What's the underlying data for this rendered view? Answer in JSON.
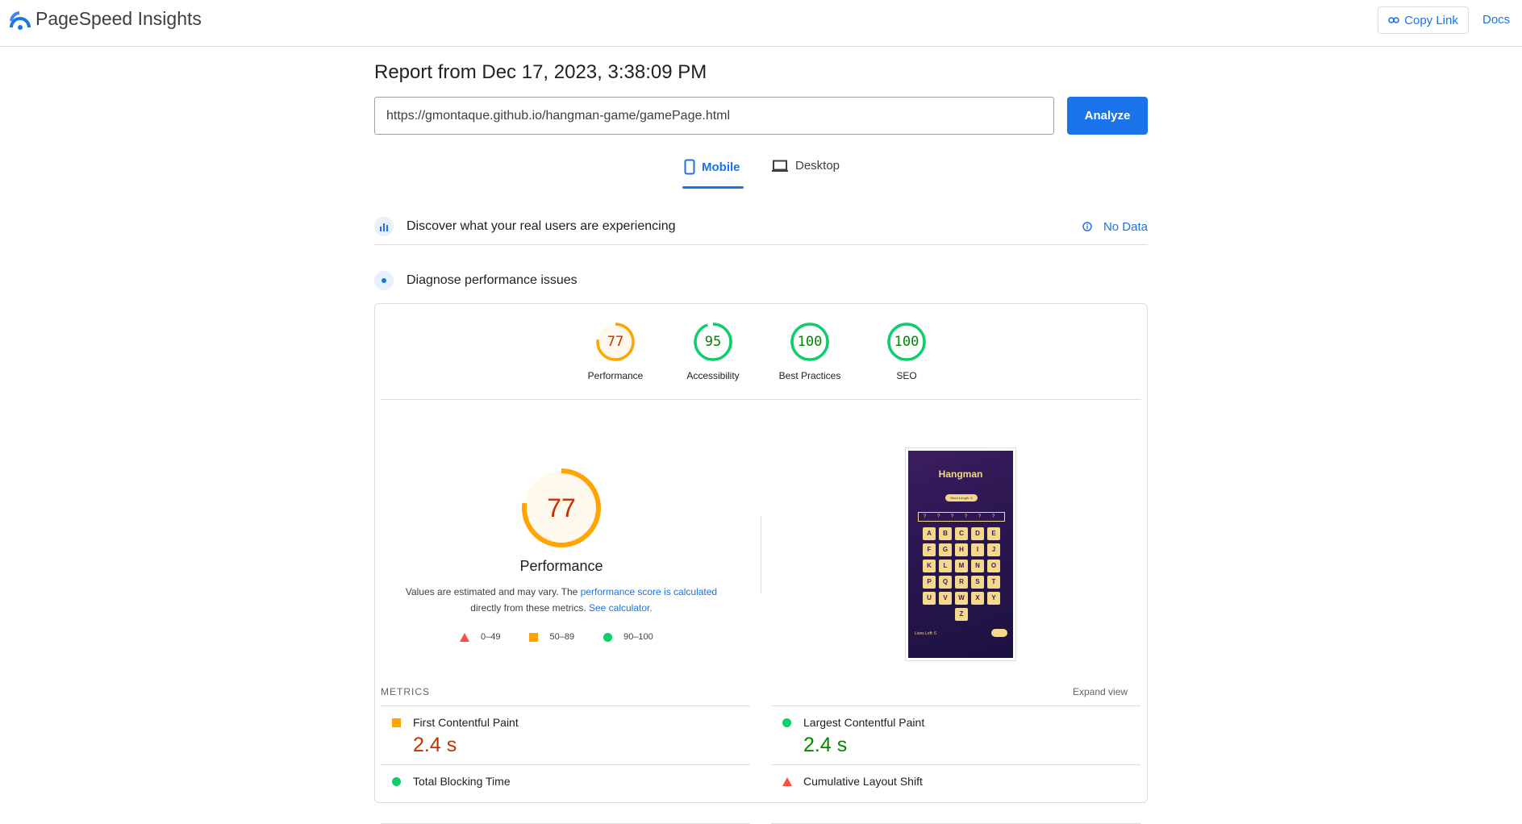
{
  "header": {
    "brand": "PageSpeed Insights",
    "copy_link": "Copy Link",
    "docs": "Docs"
  },
  "report": {
    "title": "Report from Dec 17, 2023, 3:38:09 PM",
    "url": "https://gmontaque.github.io/hangman-game/gamePage.html",
    "analyze": "Analyze"
  },
  "tabs": [
    {
      "label": "Mobile",
      "active": true
    },
    {
      "label": "Desktop",
      "active": false
    }
  ],
  "field_data": {
    "title": "Discover what your real users are experiencing",
    "status": "No Data"
  },
  "lab": {
    "title": "Diagnose performance issues"
  },
  "colors": {
    "accent": "#1a73e8",
    "average": "#ffa400",
    "pass": "#0cce6b",
    "fail": "#ff4e42"
  },
  "scores": [
    {
      "label": "Performance",
      "value": "77",
      "rating": "average"
    },
    {
      "label": "Accessibility",
      "value": "95",
      "rating": "pass"
    },
    {
      "label": "Best Practices",
      "value": "100",
      "rating": "pass"
    },
    {
      "label": "SEO",
      "value": "100",
      "rating": "pass"
    }
  ],
  "performance": {
    "score": "77",
    "title": "Performance",
    "note_pre": "Values are estimated and may vary. The ",
    "note_link": "performance score is calculated",
    "note_mid": " directly from these metrics. ",
    "note_link2": "See calculator.",
    "legend": [
      {
        "range": "0–49",
        "icon": "triangle"
      },
      {
        "range": "50–89",
        "icon": "square"
      },
      {
        "range": "90–100",
        "icon": "circle"
      }
    ]
  },
  "screenshot": {
    "title": "Hangman",
    "pill": "Word Length: 6",
    "slots": "? ? ? ? ? ?",
    "keys": [
      "A",
      "B",
      "C",
      "D",
      "E",
      "F",
      "G",
      "H",
      "I",
      "J",
      "K",
      "L",
      "M",
      "N",
      "O",
      "P",
      "Q",
      "R",
      "S",
      "T",
      "U",
      "V",
      "W",
      "X",
      "Y",
      "Z"
    ],
    "footer": "Lives Left: 6"
  },
  "metrics": {
    "heading": "METRICS",
    "expand": "Expand view",
    "items": [
      {
        "name": "First Contentful Paint",
        "value": "2.4 s",
        "rating": "average"
      },
      {
        "name": "Largest Contentful Paint",
        "value": "2.4 s",
        "rating": "pass"
      },
      {
        "name": "Total Blocking Time",
        "value": "",
        "rating": "pass"
      },
      {
        "name": "Cumulative Layout Shift",
        "value": "",
        "rating": "fail"
      }
    ]
  }
}
